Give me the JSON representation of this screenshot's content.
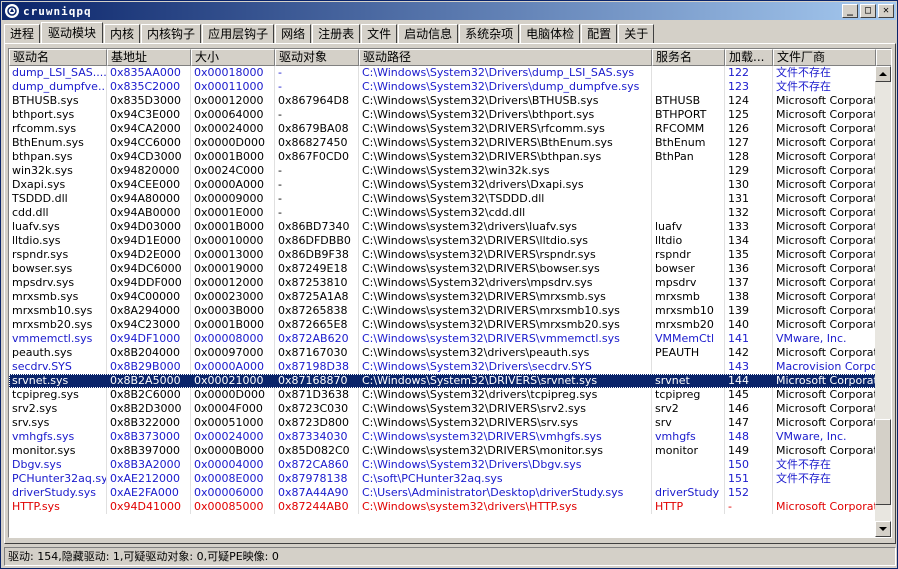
{
  "window": {
    "title": "cruwniqpq"
  },
  "tabs": [
    "进程",
    "驱动模块",
    "内核",
    "内核钩子",
    "应用层钩子",
    "网络",
    "注册表",
    "文件",
    "启动信息",
    "系统杂项",
    "电脑体检",
    "配置",
    "关于"
  ],
  "active_tab": 1,
  "columns": [
    "驱动名",
    "基地址",
    "大小",
    "驱动对象",
    "驱动路径",
    "服务名",
    "加载...",
    "文件厂商"
  ],
  "colors": {
    "blue": "#1a1acc",
    "red": "#e00000",
    "selected": "#0a246a"
  },
  "rows": [
    {
      "c": [
        "dump_LSI_SAS....",
        "0x835AA000",
        "0x00018000",
        "-",
        "C:\\Windows\\System32\\Drivers\\dump_LSI_SAS.sys",
        "",
        "122",
        "文件不存在"
      ],
      "color": "blue"
    },
    {
      "c": [
        "dump_dumpfve....",
        "0x835C2000",
        "0x00011000",
        "-",
        "C:\\Windows\\System32\\Drivers\\dump_dumpfve.sys",
        "",
        "123",
        "文件不存在"
      ],
      "color": "blue"
    },
    {
      "c": [
        "BTHUSB.sys",
        "0x835D3000",
        "0x00012000",
        "0x867964D8",
        "C:\\Windows\\System32\\Drivers\\BTHUSB.sys",
        "BTHUSB",
        "124",
        "Microsoft Corporation"
      ],
      "color": "black"
    },
    {
      "c": [
        "bthport.sys",
        "0x94C3E000",
        "0x00064000",
        "-",
        "C:\\Windows\\System32\\Drivers\\bthport.sys",
        "BTHPORT",
        "125",
        "Microsoft Corporation"
      ],
      "color": "black"
    },
    {
      "c": [
        "rfcomm.sys",
        "0x94CA2000",
        "0x00024000",
        "0x8679BA08",
        "C:\\Windows\\System32\\DRIVERS\\rfcomm.sys",
        "RFCOMM",
        "126",
        "Microsoft Corporation"
      ],
      "color": "black"
    },
    {
      "c": [
        "BthEnum.sys",
        "0x94CC6000",
        "0x0000D000",
        "0x86827450",
        "C:\\Windows\\System32\\DRIVERS\\BthEnum.sys",
        "BthEnum",
        "127",
        "Microsoft Corporation"
      ],
      "color": "black"
    },
    {
      "c": [
        "bthpan.sys",
        "0x94CD3000",
        "0x0001B000",
        "0x867F0CD0",
        "C:\\Windows\\System32\\DRIVERS\\bthpan.sys",
        "BthPan",
        "128",
        "Microsoft Corporation"
      ],
      "color": "black"
    },
    {
      "c": [
        "win32k.sys",
        "0x94820000",
        "0x0024C000",
        "-",
        "C:\\Windows\\System32\\win32k.sys",
        "",
        "129",
        "Microsoft Corporation"
      ],
      "color": "black"
    },
    {
      "c": [
        "Dxapi.sys",
        "0x94CEE000",
        "0x0000A000",
        "-",
        "C:\\Windows\\System32\\drivers\\Dxapi.sys",
        "",
        "130",
        "Microsoft Corporation"
      ],
      "color": "black"
    },
    {
      "c": [
        "TSDDD.dll",
        "0x94A80000",
        "0x00009000",
        "-",
        "C:\\Windows\\System32\\TSDDD.dll",
        "",
        "131",
        "Microsoft Corporation"
      ],
      "color": "black"
    },
    {
      "c": [
        "cdd.dll",
        "0x94AB0000",
        "0x0001E000",
        "-",
        "C:\\Windows\\System32\\cdd.dll",
        "",
        "132",
        "Microsoft Corporation"
      ],
      "color": "black"
    },
    {
      "c": [
        "luafv.sys",
        "0x94D03000",
        "0x0001B000",
        "0x86BD7340",
        "C:\\Windows\\system32\\drivers\\luafv.sys",
        "luafv",
        "133",
        "Microsoft Corporation"
      ],
      "color": "black"
    },
    {
      "c": [
        "lltdio.sys",
        "0x94D1E000",
        "0x00010000",
        "0x86DFDBB0",
        "C:\\Windows\\system32\\DRIVERS\\lltdio.sys",
        "lltdio",
        "134",
        "Microsoft Corporation"
      ],
      "color": "black"
    },
    {
      "c": [
        "rspndr.sys",
        "0x94D2E000",
        "0x00013000",
        "0x86DB9F38",
        "C:\\Windows\\system32\\DRIVERS\\rspndr.sys",
        "rspndr",
        "135",
        "Microsoft Corporation"
      ],
      "color": "black"
    },
    {
      "c": [
        "bowser.sys",
        "0x94DC6000",
        "0x00019000",
        "0x87249E18",
        "C:\\Windows\\system32\\DRIVERS\\bowser.sys",
        "bowser",
        "136",
        "Microsoft Corporation"
      ],
      "color": "black"
    },
    {
      "c": [
        "mpsdrv.sys",
        "0x94DDF000",
        "0x00012000",
        "0x87253810",
        "C:\\Windows\\System32\\drivers\\mpsdrv.sys",
        "mpsdrv",
        "137",
        "Microsoft Corporation"
      ],
      "color": "black"
    },
    {
      "c": [
        "mrxsmb.sys",
        "0x94C00000",
        "0x00023000",
        "0x8725A1A8",
        "C:\\Windows\\system32\\DRIVERS\\mrxsmb.sys",
        "mrxsmb",
        "138",
        "Microsoft Corporation"
      ],
      "color": "black"
    },
    {
      "c": [
        "mrxsmb10.sys",
        "0x8A294000",
        "0x0003B000",
        "0x87265838",
        "C:\\Windows\\system32\\DRIVERS\\mrxsmb10.sys",
        "mrxsmb10",
        "139",
        "Microsoft Corporation"
      ],
      "color": "black"
    },
    {
      "c": [
        "mrxsmb20.sys",
        "0x94C23000",
        "0x0001B000",
        "0x872665E8",
        "C:\\Windows\\system32\\DRIVERS\\mrxsmb20.sys",
        "mrxsmb20",
        "140",
        "Microsoft Corporation"
      ],
      "color": "black"
    },
    {
      "c": [
        "vmmemctl.sys",
        "0x94DF1000",
        "0x00008000",
        "0x872AB620",
        "C:\\Windows\\system32\\DRIVERS\\vmmemctl.sys",
        "VMMemCtl",
        "141",
        "VMware, Inc."
      ],
      "color": "blue"
    },
    {
      "c": [
        "peauth.sys",
        "0x8B204000",
        "0x00097000",
        "0x87167030",
        "C:\\Windows\\system32\\drivers\\peauth.sys",
        "PEAUTH",
        "142",
        "Microsoft Corporation"
      ],
      "color": "black"
    },
    {
      "c": [
        "secdrv.SYS",
        "0x8B29B000",
        "0x0000A000",
        "0x87198D38",
        "C:\\Windows\\System32\\Drivers\\secdrv.SYS",
        "",
        "143",
        "Macrovision Corpor..."
      ],
      "color": "blue"
    },
    {
      "c": [
        "srvnet.sys",
        "0x8B2A5000",
        "0x00021000",
        "0x87168870",
        "C:\\Windows\\System32\\DRIVERS\\srvnet.sys",
        "srvnet",
        "144",
        "Microsoft Corporation"
      ],
      "color": "black",
      "selected": true
    },
    {
      "c": [
        "tcpipreg.sys",
        "0x8B2C6000",
        "0x0000D000",
        "0x871D3638",
        "C:\\Windows\\System32\\drivers\\tcpipreg.sys",
        "tcpipreg",
        "145",
        "Microsoft Corporation"
      ],
      "color": "black"
    },
    {
      "c": [
        "srv2.sys",
        "0x8B2D3000",
        "0x0004F000",
        "0x8723C030",
        "C:\\Windows\\System32\\DRIVERS\\srv2.sys",
        "srv2",
        "146",
        "Microsoft Corporation"
      ],
      "color": "black"
    },
    {
      "c": [
        "srv.sys",
        "0x8B322000",
        "0x00051000",
        "0x8723D800",
        "C:\\Windows\\System32\\DRIVERS\\srv.sys",
        "srv",
        "147",
        "Microsoft Corporation"
      ],
      "color": "black"
    },
    {
      "c": [
        "vmhgfs.sys",
        "0x8B373000",
        "0x00024000",
        "0x87334030",
        "C:\\Windows\\system32\\DRIVERS\\vmhgfs.sys",
        "vmhgfs",
        "148",
        "VMware, Inc."
      ],
      "color": "blue"
    },
    {
      "c": [
        "monitor.sys",
        "0x8B397000",
        "0x0000B000",
        "0x85D082C0",
        "C:\\Windows\\system32\\DRIVERS\\monitor.sys",
        "monitor",
        "149",
        "Microsoft Corporation"
      ],
      "color": "black"
    },
    {
      "c": [
        "Dbgv.sys",
        "0x8B3A2000",
        "0x00004000",
        "0x872CA860",
        "C:\\Windows\\System32\\Drivers\\Dbgv.sys",
        "",
        "150",
        "文件不存在"
      ],
      "color": "blue"
    },
    {
      "c": [
        "PCHunter32aq.sys",
        "0xAE212000",
        "0x0008E000",
        "0x87978138",
        "C:\\soft\\PCHunter32aq.sys",
        "",
        "151",
        "文件不存在"
      ],
      "color": "blue"
    },
    {
      "c": [
        "driverStudy.sys",
        "0xAE2FA000",
        "0x00006000",
        "0x87A44A90",
        "C:\\Users\\Administrator\\Desktop\\driverStudy.sys",
        "driverStudy",
        "152",
        ""
      ],
      "color": "blue"
    },
    {
      "c": [
        "HTTP.sys",
        "0x94D41000",
        "0x00085000",
        "0x87244AB0",
        "C:\\Windows\\system32\\drivers\\HTTP.sys",
        "HTTP",
        "-",
        "Microsoft Corporation"
      ],
      "color": "red"
    }
  ],
  "status": {
    "text": "驱动: 154,隐藏驱动: 1,可疑驱动对象: 0,可疑PE映像: 0"
  }
}
